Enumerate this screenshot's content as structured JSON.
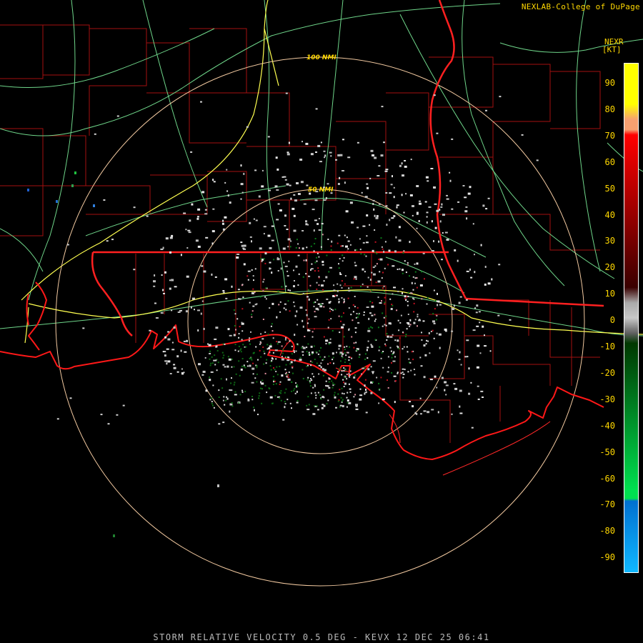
{
  "header": {
    "credit": "NEXLAB-College of DuPage",
    "product_code": "NEXR",
    "units": "[KT]"
  },
  "rings": [
    {
      "label": "100 NMI"
    },
    {
      "label": "50 NMI"
    }
  ],
  "legend": {
    "ticks": [
      "90",
      "80",
      "70",
      "60",
      "50",
      "40",
      "30",
      "20",
      "10",
      "0",
      "-10",
      "-20",
      "-30",
      "-40",
      "-50",
      "-60",
      "-70",
      "-80",
      "-90"
    ],
    "colors": {
      "top": "#ffff00",
      "orange": "#f7a070",
      "red": "#ff0000",
      "darkred": "#3a0000",
      "gray": "#c8c8c8",
      "darkgreen": "#003800",
      "green": "#00e050",
      "blue": "#0070d0",
      "lightblue": "#10b8ff"
    }
  },
  "map_colors": {
    "state_border": "#ff2020",
    "county_lines": "#b01010",
    "highways_primary": "#ffff60",
    "highways_secondary": "#70e090",
    "range_rings": "#f0c8a0"
  },
  "footer": {
    "caption": "STORM RELATIVE VELOCITY 0.5 DEG - KEVX 12 DEC 25 06:41"
  }
}
